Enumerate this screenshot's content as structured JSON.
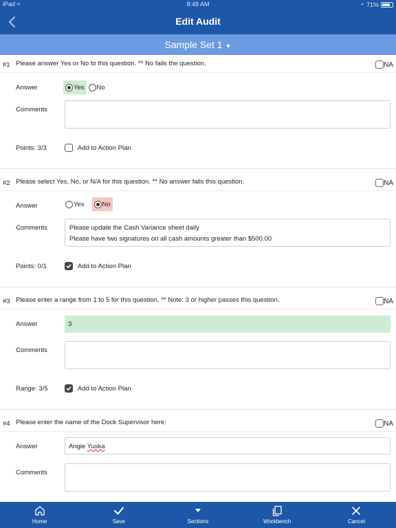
{
  "status": {
    "device": "iPad",
    "time": "8:48 AM",
    "battery": "71%"
  },
  "nav": {
    "title": "Edit Audit"
  },
  "section": {
    "label": "Sample Set 1"
  },
  "labels": {
    "answer": "Answer",
    "comments": "Comments",
    "na": "NA",
    "add_to_action_plan": "Add to Action Plan"
  },
  "questions": [
    {
      "num": "#1",
      "text": "Please answer Yes or No to this question. ** No fails the question.",
      "options": [
        "Yes",
        "No"
      ],
      "selected": "Yes",
      "comment_lines": [],
      "score": "Points: 3/3",
      "add_to_plan": false
    },
    {
      "num": "#2",
      "text": "Please select Yes, No, or N/A for this question. ** No answer fails this question.",
      "options": [
        "Yes",
        "No"
      ],
      "selected": "No",
      "comment_lines": [
        "Please update the Cash Variance sheet daily",
        "Please have two signatures on all cash amounts greater than $500.00"
      ],
      "score": "Points: 0/1",
      "add_to_plan": true
    },
    {
      "num": "#3",
      "text": "Please enter a range from 1 to 5 for this question. ** Note: 3 or higher passes this question.",
      "answer_value": "3",
      "comment_lines": [],
      "score": "Range: 3/5",
      "add_to_plan": true
    },
    {
      "num": "#4",
      "text": "Please enter the name of the Dock Supervisor here:",
      "answer_value_first": "Angie",
      "answer_value_last": "Yuska",
      "comment_lines": []
    }
  ],
  "tabs": [
    {
      "label": "Home",
      "icon": "home-icon"
    },
    {
      "label": "Save",
      "icon": "checkmark-icon"
    },
    {
      "label": "Sections",
      "icon": "caret-down-icon"
    },
    {
      "label": "Workbench",
      "icon": "workbench-icon"
    },
    {
      "label": "Cancel",
      "icon": "close-icon"
    }
  ],
  "colors": {
    "nav_blue": "#1d57a8",
    "section_blue": "#6b9be0",
    "pass_green": "#cdebd4",
    "fail_red": "#f7c6c6"
  }
}
